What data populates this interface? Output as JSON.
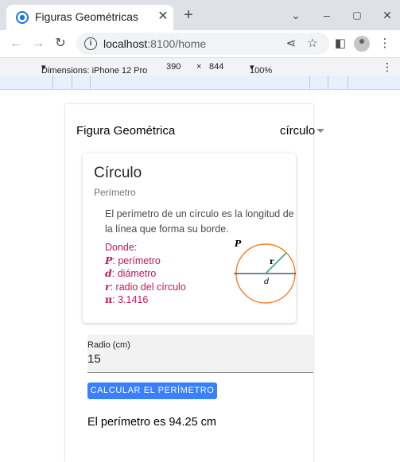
{
  "browser": {
    "tab_title": "Figuras Geométricas",
    "url_host": "localhost",
    "url_path": ":8100/home"
  },
  "devtools": {
    "dimensions_label": "Dimensions: iPhone 12 Pro",
    "width": "390",
    "separator": "×",
    "height": "844",
    "zoom": "100%"
  },
  "app": {
    "shape_label": "Figura Geométrica",
    "shape_selected": "círculo",
    "card": {
      "title": "Círculo",
      "subtitle": "Perímetro",
      "description": "El perímetro de un círculo es la longitud de la línea que forma su borde.",
      "legend": {
        "heading": "Donde:",
        "items": [
          {
            "symbol": "P",
            "text": ": perímetro"
          },
          {
            "symbol": "d",
            "text": ": diámetro"
          },
          {
            "symbol": "r",
            "text": ": radio del círculo"
          },
          {
            "symbol": "π",
            "text": ": 3.1416"
          }
        ]
      },
      "diagram": {
        "perimeter_symbol": "P",
        "radius_symbol": "r",
        "diameter_symbol": "d"
      }
    },
    "radius_field": {
      "label": "Radio (cm)",
      "value": "15"
    },
    "calculate_button": "CALCULAR EL PERÍMETRO",
    "result": "El perímetro es 94.25 cm"
  },
  "colors": {
    "accent": "#3880ff",
    "legend": "#c2185b",
    "circle": "#ff7d27",
    "radius_line": "#2fb36b"
  }
}
